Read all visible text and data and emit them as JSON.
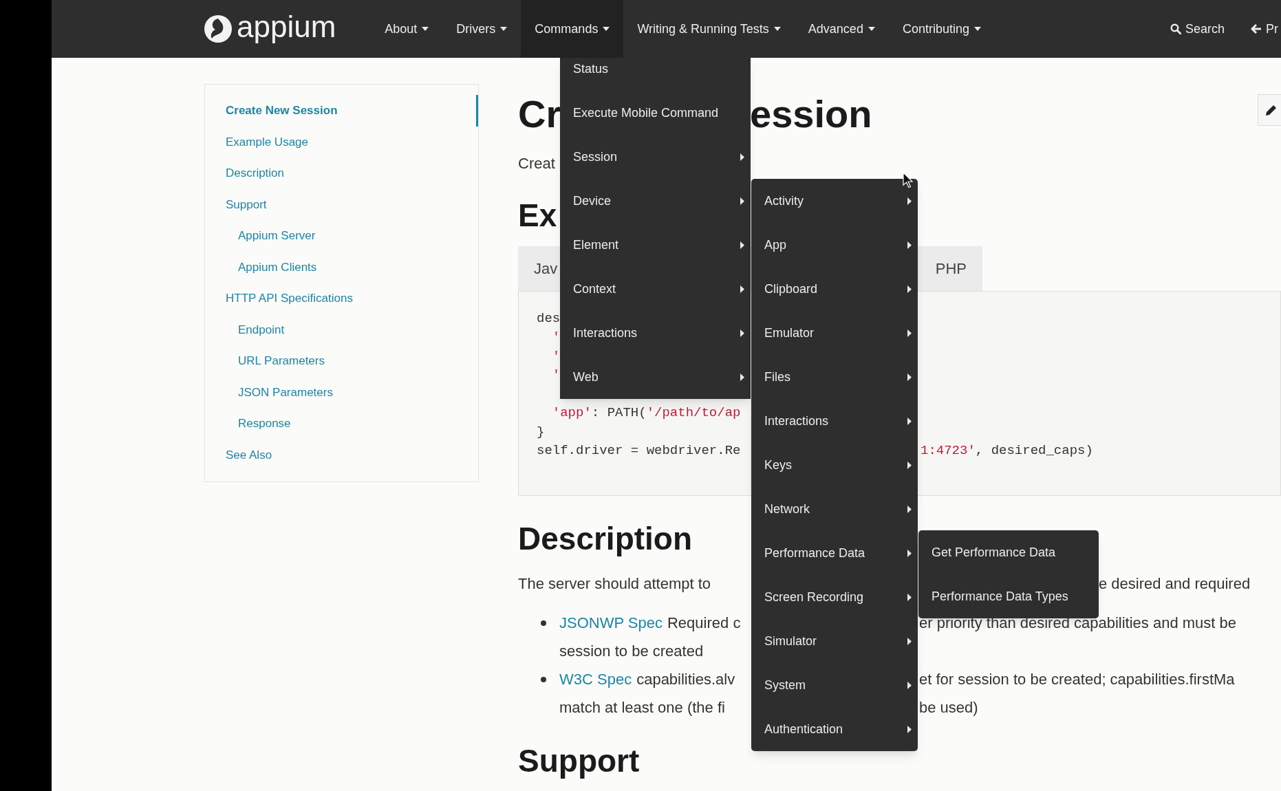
{
  "nav": {
    "logo": "appium",
    "items": [
      {
        "label": "About",
        "selected": false
      },
      {
        "label": "Drivers",
        "selected": false
      },
      {
        "label": "Commands",
        "selected": true
      },
      {
        "label": "Writing & Running Tests",
        "selected": false
      },
      {
        "label": "Advanced",
        "selected": false
      },
      {
        "label": "Contributing",
        "selected": false
      }
    ],
    "search": "Search",
    "prev": "Pr"
  },
  "sidebar": {
    "items": [
      {
        "label": "Create New Session",
        "selected": true
      },
      {
        "label": "Example Usage",
        "selected": false
      },
      {
        "label": "Description",
        "selected": false
      },
      {
        "label": "Support",
        "selected": false,
        "children": [
          {
            "label": "Appium Server",
            "selected": false
          },
          {
            "label": "Appium Clients",
            "selected": false
          }
        ]
      },
      {
        "label": "HTTP API Specifications",
        "selected": false,
        "children": [
          {
            "label": "Endpoint",
            "selected": false
          },
          {
            "label": "URL Parameters",
            "selected": false
          },
          {
            "label": "JSON Parameters",
            "selected": false
          },
          {
            "label": "Response",
            "selected": false
          }
        ]
      },
      {
        "label": "See Also",
        "selected": false
      }
    ]
  },
  "content": {
    "title": {
      "start": "Cr",
      "end": "ession"
    },
    "intro": "Creat",
    "example_heading": "Ex",
    "code_tabs": [
      {
        "label": "Jav"
      },
      {
        "label": "PHP"
      }
    ],
    "code_lines": [
      {
        "left": [
          {
            "kind": "plain",
            "text": "des"
          }
        ]
      },
      {
        "left": [
          {
            "kind": "string",
            "text": "  '"
          }
        ]
      },
      {
        "left": [
          {
            "kind": "string",
            "text": "  '"
          }
        ]
      },
      {
        "left": [
          {
            "kind": "string",
            "text": "  '"
          }
        ]
      },
      {
        "gap_before": true,
        "left": [
          {
            "kind": "string",
            "text": "  'app'"
          },
          {
            "kind": "plain",
            "text": ": PATH("
          },
          {
            "kind": "string",
            "text": "'/path/to/ap"
          }
        ]
      },
      {
        "left": [
          {
            "kind": "plain",
            "text": "}"
          }
        ]
      },
      {
        "left": [
          {
            "kind": "plain",
            "text": "self.driver = webdriver.Re"
          }
        ],
        "right": [
          {
            "kind": "string",
            "text": "1:4723'"
          },
          {
            "kind": "plain",
            "text": ", desired_caps)"
          }
        ]
      }
    ],
    "description_heading": "Description",
    "description": {
      "left": "The server should attempt to",
      "right": "e desired and required"
    },
    "bullets": [
      {
        "link": "JSONWP Spec",
        "left": "Required c",
        "right": "er priority than desired capabilities and must be",
        "second_left": "session to be created"
      },
      {
        "link": "W3C Spec",
        "left": "capabilities.alv",
        "right": "et for session to be created; capabilities.firstMa",
        "second_left": "match at least one (the fi",
        "second_right": "be used)"
      }
    ],
    "support_heading": "Support"
  },
  "commands_menu": {
    "items": [
      {
        "label": "Status",
        "submenu": false
      },
      {
        "label": "Execute Mobile Command",
        "submenu": false
      },
      {
        "label": "Session",
        "submenu": true
      },
      {
        "label": "Device",
        "submenu": true
      },
      {
        "label": "Element",
        "submenu": true
      },
      {
        "label": "Context",
        "submenu": true
      },
      {
        "label": "Interactions",
        "submenu": true
      },
      {
        "label": "Web",
        "submenu": true
      }
    ]
  },
  "device_menu": {
    "items": [
      {
        "label": "Activity",
        "submenu": true
      },
      {
        "label": "App",
        "submenu": true
      },
      {
        "label": "Clipboard",
        "submenu": true
      },
      {
        "label": "Emulator",
        "submenu": true
      },
      {
        "label": "Files",
        "submenu": true
      },
      {
        "label": "Interactions",
        "submenu": true
      },
      {
        "label": "Keys",
        "submenu": true
      },
      {
        "label": "Network",
        "submenu": true
      },
      {
        "label": "Performance Data",
        "submenu": true
      },
      {
        "label": "Screen Recording",
        "submenu": true
      },
      {
        "label": "Simulator",
        "submenu": true
      },
      {
        "label": "System",
        "submenu": true
      },
      {
        "label": "Authentication",
        "submenu": true
      }
    ]
  },
  "performance_menu": {
    "items": [
      {
        "label": "Get Performance Data",
        "submenu": false
      },
      {
        "label": "Performance Data Types",
        "submenu": false
      }
    ]
  }
}
